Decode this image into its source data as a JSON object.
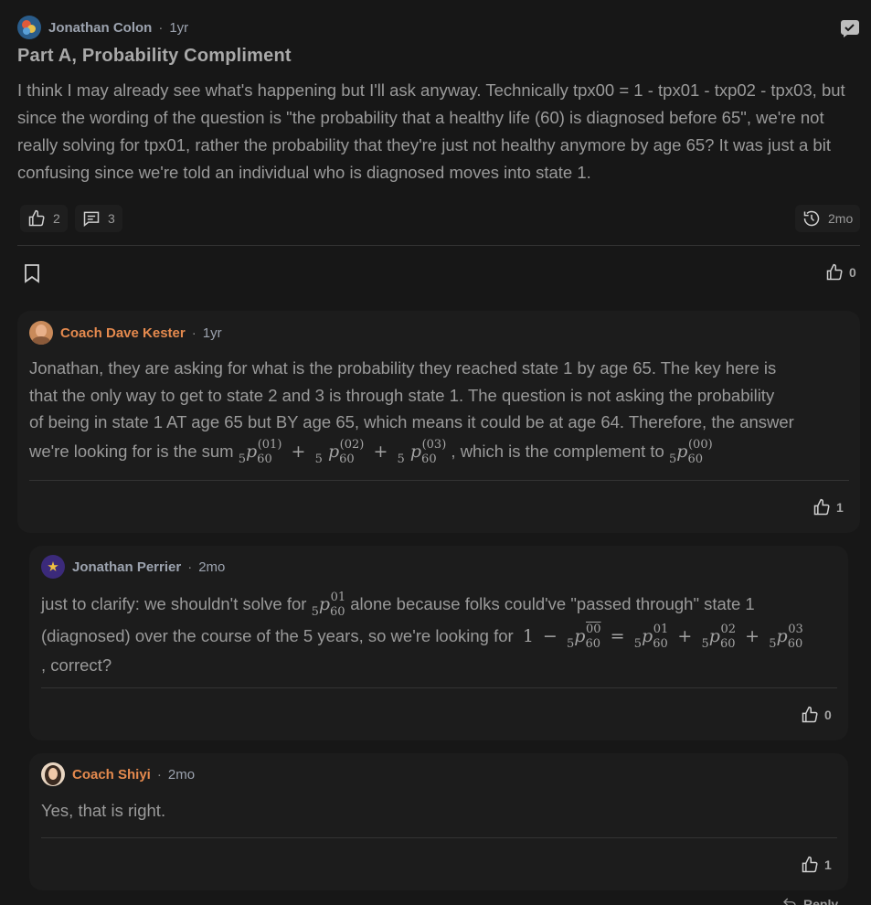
{
  "post": {
    "author": "Jonathan Colon",
    "time": "1yr",
    "title": "Part A, Probability Compliment",
    "body": "I think I may already see what's happening but I'll ask anyway. Technically tpx00 = 1 - tpx01 - txp02 - tpx03, but since the wording of the question is \"the probability that a healthy life (60) is diagnosed before 65\", we're not really solving for tpx01, rather the probability that they're just not healthy anymore by age 65? It was just a bit confusing since we're told an individual who is diagnosed moves into state 1.",
    "likes": "2",
    "comments": "3",
    "activity": "2mo",
    "bookmark_likes": "0"
  },
  "replies": [
    {
      "author": "Coach Dave Kester",
      "time": "1yr",
      "text_lines": [
        "Jonathan, they are asking for what is the probability they reached state 1 by age 65. The key here is",
        "that the only way to get to state 2 and 3 is through state 1. The question is not asking the probability",
        "of being in state 1 AT age 65 but BY age 65, which means it could be at age 64. Therefore, the answer"
      ],
      "text_last_a": "we're looking for is the sum",
      "text_last_b": ", which is the complement to",
      "likes": "1"
    },
    {
      "author": "Jonathan Perrier",
      "time": "2mo",
      "text_a": "just to clarify: we shouldn't solve for",
      "text_b": "alone because folks could've \"passed through\" state 1",
      "text_c": "(diagnosed) over the course of the 5 years, so we're looking for",
      "text_d": ", correct?",
      "likes": "0"
    },
    {
      "author": "Coach Shiyi",
      "time": "2mo",
      "text": "Yes, that is right.",
      "likes": "1"
    }
  ],
  "math": {
    "p": "p",
    "five": "5",
    "sixty": "60",
    "s01": "(01)",
    "s02": "(02)",
    "s03": "(03)",
    "s00": "(00)",
    "b01": "01",
    "b02": "02",
    "b03": "03",
    "b00": "00",
    "plus": "+",
    "minus": "−",
    "eq": "=",
    "one": "1"
  },
  "footer": {
    "reply_label": "Reply"
  }
}
